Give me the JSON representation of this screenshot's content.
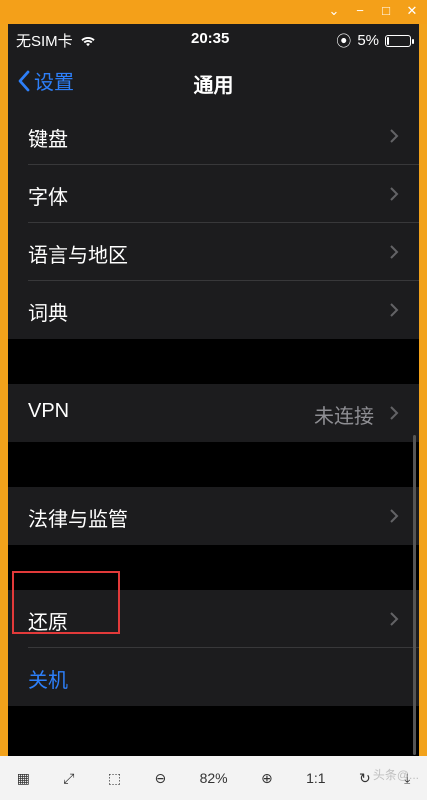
{
  "window": {
    "controls": [
      "⌄",
      "−",
      "□",
      "✕"
    ]
  },
  "statusbar": {
    "carrier": "无SIM卡",
    "time": "20:35",
    "battery": "5%",
    "battery_level": 0.05
  },
  "nav": {
    "back_label": "设置",
    "title": "通用"
  },
  "sections": [
    {
      "rows": [
        {
          "label": "键盘"
        },
        {
          "label": "字体"
        },
        {
          "label": "语言与地区"
        },
        {
          "label": "词典"
        }
      ]
    },
    {
      "rows": [
        {
          "label": "VPN",
          "value": "未连接"
        }
      ]
    },
    {
      "rows": [
        {
          "label": "法律与监管"
        }
      ]
    },
    {
      "rows": [
        {
          "label": "还原"
        },
        {
          "label": "关机",
          "accent": true
        }
      ]
    }
  ],
  "toolbar": {
    "zoom": "82%",
    "one_to_one": "1:1"
  },
  "watermark": "头条@..."
}
